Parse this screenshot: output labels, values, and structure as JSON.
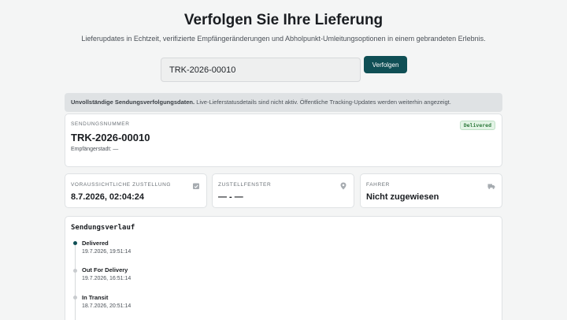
{
  "header": {
    "title": "Verfolgen Sie Ihre Lieferung",
    "subtitle": "Lieferupdates in Echtzeit, verifizierte Empfängeränderungen und Abholpunkt-Umleitungsoptionen in einem gebrandeten Erlebnis."
  },
  "search": {
    "value": "TRK-2026-00010",
    "button_label": "Verfolgen"
  },
  "notice": {
    "bold": "Unvollständige Sendungsverfolgungsdaten.",
    "text": " Live-Lieferstatusdetails sind nicht aktiv. Öffentliche Tracking-Updates werden weiterhin angezeigt."
  },
  "shipment": {
    "label": "Sendungsnummer",
    "number": "TRK-2026-00010",
    "city": "Empfängerstadt: —",
    "status_badge": "Delivered"
  },
  "info_cards": {
    "estimated": {
      "label": "Voraussichtliche Zustellung",
      "value": "8.7.2026, 02:04:24",
      "icon": "calendar-icon"
    },
    "window": {
      "label": "Zustellfenster",
      "value": "— - —",
      "icon": "location-pin-icon"
    },
    "driver": {
      "label": "Fahrer",
      "value": "Nicht zugewiesen",
      "icon": "truck-icon"
    }
  },
  "history": {
    "title": "Sendungsverlauf",
    "events": [
      {
        "status": "Delivered",
        "time": "19.7.2026, 19:51:14"
      },
      {
        "status": "Out For Delivery",
        "time": "19.7.2026, 16:51:14"
      },
      {
        "status": "In Transit",
        "time": "18.7.2026, 20:51:14"
      }
    ]
  },
  "colors": {
    "primary": "#0f4f55",
    "badge_green": "#2f7a3d"
  }
}
